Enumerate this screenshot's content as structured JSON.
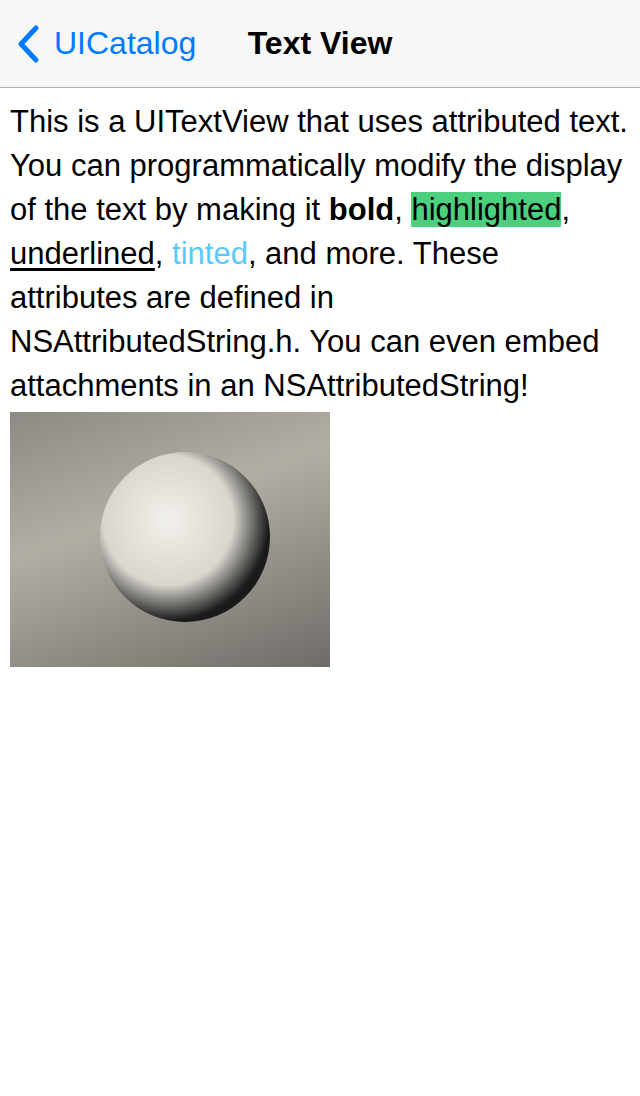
{
  "nav": {
    "back": "UICatalog",
    "title": "Text View"
  },
  "body": [
    {
      "kind": "plain",
      "text": "This is a UITextView that uses attributed text. You can programmatically modify the display of the text by making it "
    },
    {
      "kind": "bold",
      "text": "bold"
    },
    {
      "kind": "plain",
      "text": ", "
    },
    {
      "kind": "highlight",
      "text": "highlighted"
    },
    {
      "kind": "plain",
      "text": ", "
    },
    {
      "kind": "underline",
      "text": "underlined"
    },
    {
      "kind": "plain",
      "text": ", "
    },
    {
      "kind": "tint",
      "text": "tinted"
    },
    {
      "kind": "plain",
      "text": ", and more. These attributes are defined in NSAttributedString.h. You can even embed attachments in an NSAttributedString!"
    }
  ]
}
